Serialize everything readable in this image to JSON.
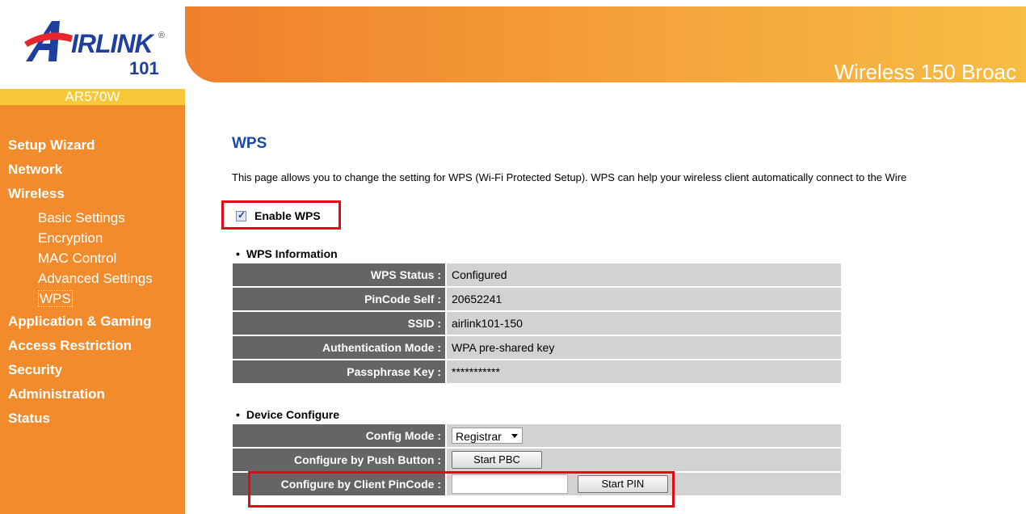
{
  "brand": {
    "logo_letter": "A",
    "logo_text": "IRLINK",
    "logo_number": "101",
    "registered_mark": "®",
    "model": "AR570W"
  },
  "header": {
    "title": "Wireless 150 Broac"
  },
  "sidebar": {
    "main_items": [
      {
        "label": "Setup Wizard"
      },
      {
        "label": "Network"
      },
      {
        "label": "Wireless"
      }
    ],
    "sub_items": [
      {
        "label": "Basic Settings"
      },
      {
        "label": "Encryption"
      },
      {
        "label": "MAC Control"
      },
      {
        "label": "Advanced Settings"
      },
      {
        "label": "WPS"
      }
    ],
    "bottom_items": [
      {
        "label": "Application & Gaming"
      },
      {
        "label": "Access Restriction"
      },
      {
        "label": "Security"
      },
      {
        "label": "Administration"
      },
      {
        "label": "Status"
      }
    ]
  },
  "main": {
    "title": "WPS",
    "description": "This page allows you to change the setting for WPS (Wi-Fi Protected Setup). WPS can help your wireless client automatically connect to the Wire",
    "enable_label": "Enable WPS",
    "enable_checked": true,
    "wps_info": {
      "heading": "WPS Information",
      "rows": [
        {
          "label": "WPS Status :",
          "value": "Configured"
        },
        {
          "label": "PinCode Self :",
          "value": "20652241"
        },
        {
          "label": "SSID :",
          "value": "airlink101-150"
        },
        {
          "label": "Authentication Mode :",
          "value": "WPA pre-shared key"
        },
        {
          "label": "Passphrase Key :",
          "value": "***********"
        }
      ]
    },
    "device_config": {
      "heading": "Device Configure",
      "config_mode_label": "Config Mode :",
      "config_mode_value": "Registrar",
      "push_button_label": "Configure by Push Button :",
      "push_button_btn": "Start PBC",
      "pin_label": "Configure by Client PinCode :",
      "pin_value": "",
      "pin_btn": "Start PIN"
    }
  },
  "colors": {
    "sidebar": "#f28b2c",
    "model_bar": "#f6c83a",
    "title_blue": "#1a4a9e",
    "highlight_red": "#e20a16",
    "label_cell": "#656565",
    "value_cell": "#d2d2d2"
  }
}
